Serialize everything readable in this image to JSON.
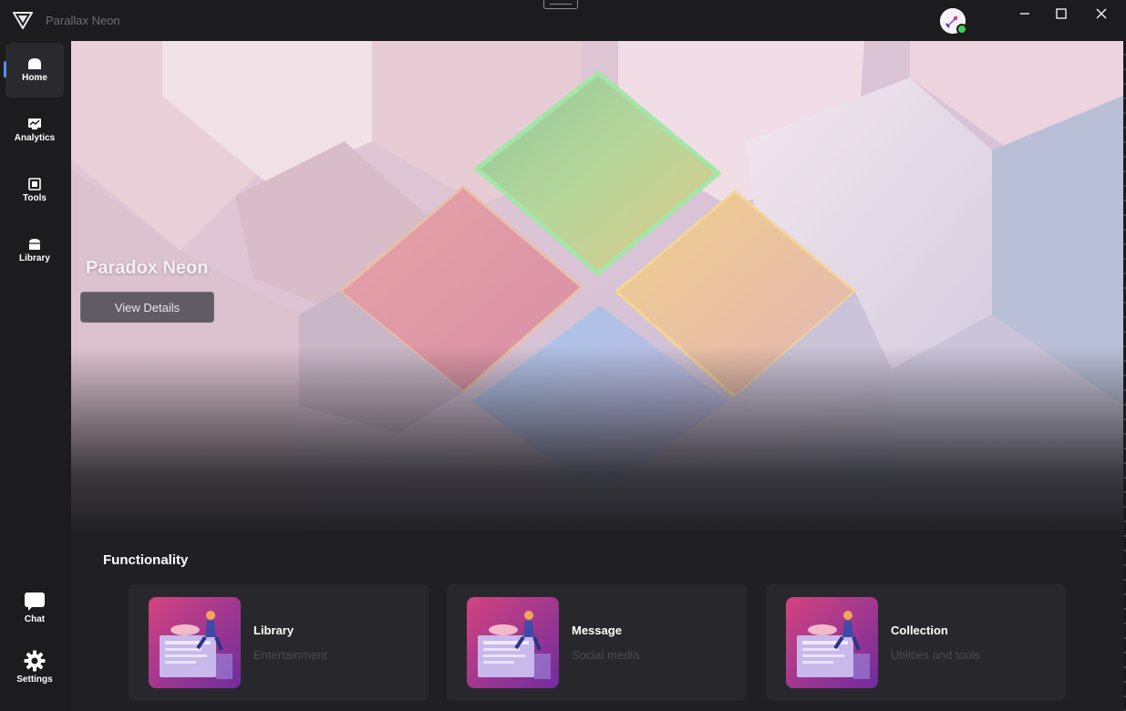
{
  "window": {
    "title": "Parallax Neon"
  },
  "sidebar": {
    "items": [
      {
        "label": "Home",
        "icon": "home-icon",
        "active": true
      },
      {
        "label": "Analytics",
        "icon": "chart-icon",
        "active": false
      },
      {
        "label": "Tools",
        "icon": "tools-icon",
        "active": false
      },
      {
        "label": "Library",
        "icon": "library-icon",
        "active": false
      }
    ],
    "bottom_items": [
      {
        "label": "Chat",
        "icon": "chat-icon"
      },
      {
        "label": "Settings",
        "icon": "gear-icon"
      }
    ]
  },
  "hero": {
    "title": "Paradox Neon",
    "button_label": "View Details"
  },
  "functionality": {
    "title": "Functionality",
    "cards": [
      {
        "title": "Library",
        "subtitle": "Entertainment"
      },
      {
        "title": "Message",
        "subtitle": "Social media"
      },
      {
        "title": "Collection",
        "subtitle": "Utilities and tools"
      }
    ]
  },
  "colors": {
    "accent": "#5a8df5",
    "background": "#202024",
    "sidebar": "#1c1c1f",
    "card": "#28282c",
    "status_online": "#3ecf5a"
  }
}
